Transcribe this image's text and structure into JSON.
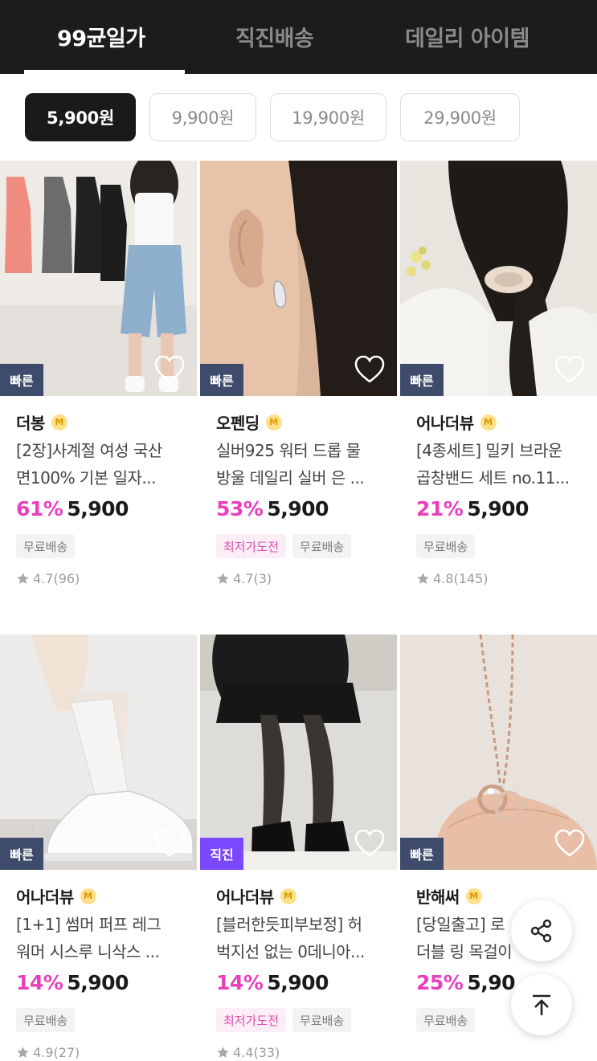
{
  "tabs": [
    {
      "label": "99균일가",
      "active": true
    },
    {
      "label": "직진배송",
      "active": false
    },
    {
      "label": "데일리 아이템",
      "active": false
    }
  ],
  "price_filters": [
    {
      "label": "5,900원",
      "active": true
    },
    {
      "label": "9,900원",
      "active": false
    },
    {
      "label": "19,900원",
      "active": false
    },
    {
      "label": "29,900원",
      "active": false
    }
  ],
  "products": [
    {
      "brand": "더봉",
      "brand_badge": "M",
      "title_line1": "[2장]사계절 여성 국산",
      "title_line2": "면100% 기본 일자...",
      "discount": "61%",
      "price": "5,900",
      "tag": "빠른",
      "badges": [
        "무료배송"
      ],
      "rating": "4.7",
      "reviews": "(96)"
    },
    {
      "brand": "오펜딩",
      "brand_badge": "M",
      "title_line1": "실버925 워터 드롭 물",
      "title_line2": "방울 데일리 실버 은 ...",
      "discount": "53%",
      "price": "5,900",
      "tag": "빠른",
      "badges": [
        "최저가도전",
        "무료배송"
      ],
      "rating": "4.7",
      "reviews": "(3)"
    },
    {
      "brand": "어나더뷰",
      "brand_badge": "M",
      "title_line1": "[4종세트] 밀키 브라운",
      "title_line2": "곱창밴드 세트 no.11...",
      "discount": "21%",
      "price": "5,900",
      "tag": "빠른",
      "badges": [
        "무료배송"
      ],
      "rating": "4.8",
      "reviews": "(145)"
    },
    {
      "brand": "어나더뷰",
      "brand_badge": "M",
      "title_line1": "[1+1] 썸머 퍼프 레그",
      "title_line2": "워머 시스루 니삭스 ...",
      "discount": "14%",
      "price": "5,900",
      "tag": "빠른",
      "badges": [
        "무료배송"
      ],
      "rating": "4.9",
      "reviews": "(27)"
    },
    {
      "brand": "어나더뷰",
      "brand_badge": "M",
      "title_line1": "[블러한듯피부보정] 허",
      "title_line2": "벅지선 없는 0데니아...",
      "discount": "14%",
      "price": "5,900",
      "tag": "직진",
      "badges": [
        "최저가도전",
        "무료배송"
      ],
      "rating": "4.4",
      "reviews": "(33)"
    },
    {
      "brand": "반해써",
      "brand_badge": "M",
      "title_line1": "[당일출고] 로",
      "title_line2": "더블 링 목걸이",
      "discount": "25%",
      "price": "5,90",
      "tag": "빠른",
      "badges": [
        "무료배송"
      ],
      "rating": "",
      "reviews": ""
    }
  ],
  "icons": {
    "heart": "heart-outline-icon",
    "star": "star-icon",
    "share": "share-icon",
    "top": "arrow-up-to-top-icon"
  },
  "colors": {
    "topbar_bg": "#1c1c1c",
    "discount": "#ea3fbd",
    "tag_fast": "#3f4b6b",
    "tag_direct": "#7b47ff",
    "badge_pink_text": "#e04aad"
  }
}
